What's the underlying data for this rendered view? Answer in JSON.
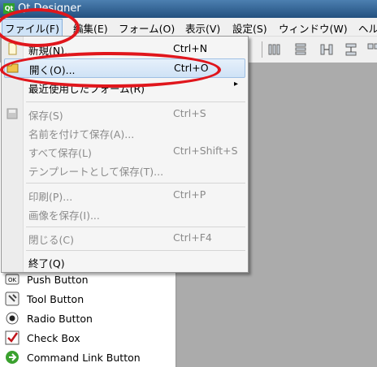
{
  "window": {
    "title": "Qt Designer",
    "app_icon": "qt-logo-icon"
  },
  "menubar": {
    "items": [
      {
        "label": "ファイル(F)",
        "active": true
      },
      {
        "label": "編集(E)"
      },
      {
        "label": "フォーム(O)"
      },
      {
        "label": "表示(V)"
      },
      {
        "label": "設定(S)"
      },
      {
        "label": "ウィンドウ(W)"
      },
      {
        "label": "ヘル"
      }
    ]
  },
  "file_menu": {
    "items": [
      {
        "label": "新規(N)...",
        "shortcut": "Ctrl+N",
        "icon": "new-file-icon"
      },
      {
        "label": "開く(O)...",
        "shortcut": "Ctrl+O",
        "icon": "open-folder-icon",
        "highlighted": true
      },
      {
        "label": "最近使用したフォーム(R)",
        "submenu_arrow": "▸"
      },
      {
        "label": "保存(S)",
        "shortcut": "Ctrl+S",
        "icon": "save-icon",
        "disabled": true
      },
      {
        "label": "名前を付けて保存(A)...",
        "disabled": true
      },
      {
        "label": "すべて保存(L)",
        "shortcut": "Ctrl+Shift+S",
        "disabled": true
      },
      {
        "label": "テンプレートとして保存(T)...",
        "disabled": true
      },
      {
        "label": "印刷(P)...",
        "shortcut": "Ctrl+P",
        "disabled": true
      },
      {
        "label": "画像を保存(I)...",
        "disabled": true
      },
      {
        "label": "閉じる(C)",
        "shortcut": "Ctrl+F4",
        "disabled": true
      },
      {
        "label": "終了(Q)"
      }
    ]
  },
  "widget_box": {
    "items": [
      {
        "label": "Push Button",
        "icon": "push-button-icon"
      },
      {
        "label": "Tool Button",
        "icon": "tool-button-icon"
      },
      {
        "label": "Radio Button",
        "icon": "radio-button-icon"
      },
      {
        "label": "Check Box",
        "icon": "check-box-icon"
      },
      {
        "label": "Command Link Button",
        "icon": "command-link-icon"
      }
    ]
  },
  "colors": {
    "annotation_ring": "#e0161c",
    "highlight": "#cfe2f6",
    "workspace": "#ababab"
  }
}
